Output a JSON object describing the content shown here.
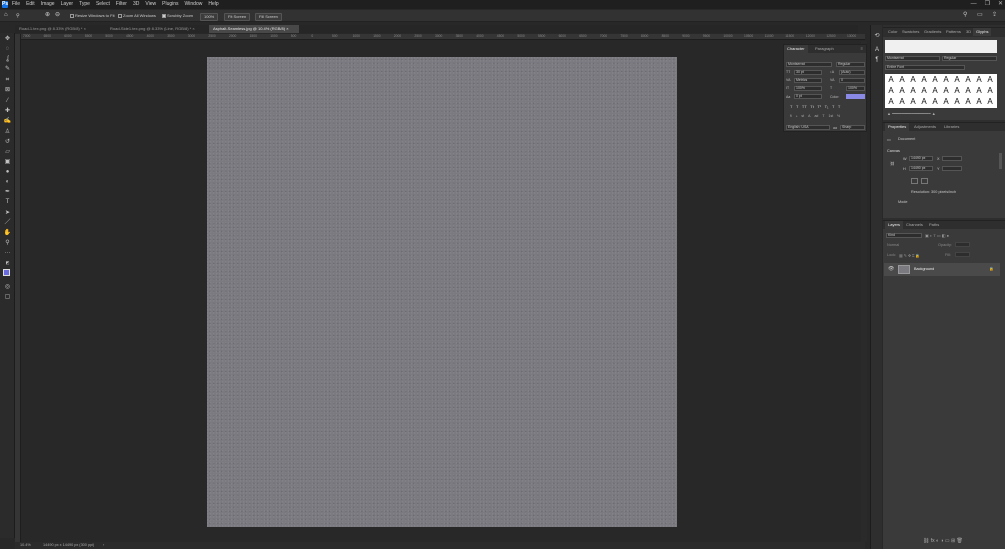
{
  "menubar": {
    "logo": "Ps",
    "items": [
      "File",
      "Edit",
      "Image",
      "Layer",
      "Type",
      "Select",
      "Filter",
      "3D",
      "View",
      "Plugins",
      "Window",
      "Help"
    ],
    "window_controls": [
      "—",
      "❐",
      "✕"
    ]
  },
  "options": {
    "resize_windows": "Resize Windows to Fit",
    "zoom_all": "Zoom All Windows",
    "scrubby_zoom": "Scrubby Zoom",
    "zoom_pct": "100%",
    "fit_screen": "Fit Screen",
    "fill_screen": "Fill Screen"
  },
  "tabs": [
    {
      "label": "Road-1.tex.png @ 8.33% (RGB/8) *",
      "active": false
    },
    {
      "label": "Road-Side1.tex.png @ 8.33% (Line, RGB/8) *",
      "active": false
    },
    {
      "label": "Asphalt-Seamless.jpg @ 10.4% (RGB/8)",
      "active": true
    }
  ],
  "ruler": {
    "ticks": [
      "7000",
      "6500",
      "6000",
      "5500",
      "5000",
      "4500",
      "4000",
      "3500",
      "3000",
      "2500",
      "2000",
      "1500",
      "1000",
      "500",
      "0",
      "500",
      "1000",
      "1500",
      "2000",
      "2500",
      "3000",
      "3500",
      "4000",
      "4500",
      "5000",
      "5500",
      "6000",
      "6500",
      "7000",
      "7500",
      "8000",
      "8500",
      "9000",
      "9500",
      "10000",
      "10500",
      "11000",
      "11500",
      "12000",
      "12500",
      "13000"
    ]
  },
  "status": {
    "zoom": "10.4%",
    "doc_info": "14490 px x 14490 px (300 ppi)"
  },
  "character": {
    "tabs": [
      "Character",
      "Paragraph"
    ],
    "font_family": "Montserrat",
    "font_style": "Regular",
    "size": "30 pt",
    "leading": "(Auto)",
    "kerning": "Metrics",
    "tracking": "0",
    "vscale": "100%",
    "hscale": "100%",
    "baseline": "0 pt",
    "color_label": "Color:",
    "color": "#8a8ae6",
    "style_buttons": [
      "T",
      "T",
      "TT",
      "Tt",
      "T¹",
      "T₁",
      "T",
      "T"
    ],
    "ot_buttons": [
      "fi",
      "ℴ",
      "st",
      "A",
      "ad",
      "T",
      "1st",
      "½"
    ],
    "language": "English: USA",
    "aa_label": "aa",
    "antialias": "Sharp"
  },
  "glyphs": {
    "tabs": [
      "Color",
      "Swatches",
      "Gradients",
      "Patterns",
      "3D",
      "Glyphs"
    ],
    "font": "Montserrat",
    "style": "Regular",
    "show": "Entire Font",
    "glyph_char": "A"
  },
  "properties": {
    "tabs": [
      "Properties",
      "Adjustments",
      "Libraries"
    ],
    "type": "Document",
    "section": "Canvas",
    "w_label": "W",
    "w": "14490 px",
    "h_label": "H",
    "h": "14490 px",
    "x_label": "X",
    "y_label": "Y",
    "resolution": "Resolution: 300 pixels/inch",
    "mode": "Mode"
  },
  "layers": {
    "tabs": [
      "Layers",
      "Channels",
      "Paths"
    ],
    "kind": "Kind",
    "blend": "Normal",
    "opacity_label": "Opacity:",
    "lock_label": "Lock:",
    "fill_label": "Fill:",
    "layer_name": "Background"
  }
}
